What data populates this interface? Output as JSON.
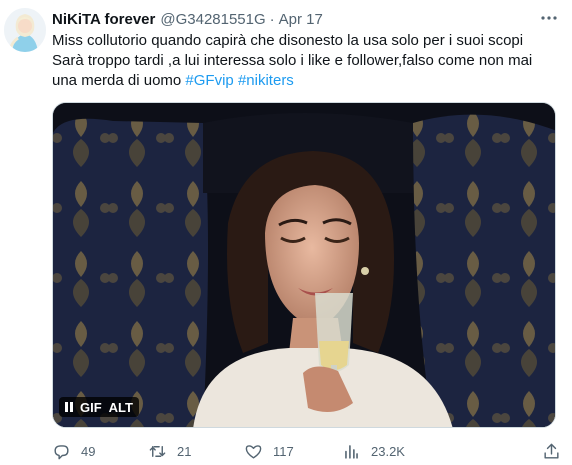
{
  "author": {
    "name": "NiKiTA forever",
    "handle": "@G34281551G",
    "separator": "·",
    "date": "Apr 17"
  },
  "tweet": {
    "line1": "Miss collutorio quando capirà che disonesto la usa solo per i suoi scopi",
    "line2": "Sarà troppo tardi ,a lui interessa solo i like e follower,falso come non mai",
    "line3_text": "una merda di uomo ",
    "hashtag1": "#GFvip",
    "hashtag2": "#nikiters"
  },
  "media": {
    "type": "gif",
    "gif_label": "GIF",
    "alt_label": "ALT"
  },
  "actions": {
    "replies": "49",
    "retweets": "21",
    "likes": "117",
    "views": "23.2K"
  },
  "icons": [
    "more-icon",
    "pause-icon",
    "reply-icon",
    "retweet-icon",
    "like-icon",
    "views-icon",
    "share-icon"
  ],
  "colors": {
    "accent": "#1d9bf0",
    "secondary_text": "#536471",
    "primary_text": "#0f1419"
  }
}
